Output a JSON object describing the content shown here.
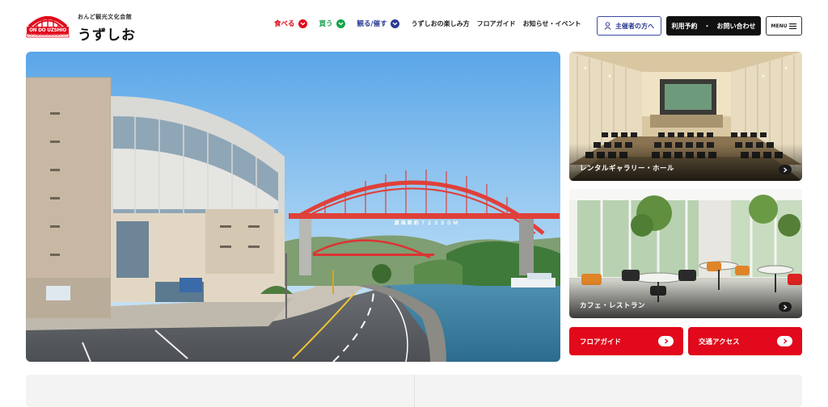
{
  "logo": {
    "badge_text": "ON DO UZSHIO",
    "badge_subtext": "ONDO KANKO BUNKA KAIKAN",
    "subtitle": "おんど観光文化会館",
    "title": "うずしお"
  },
  "nav": {
    "items": [
      {
        "label": "食べる",
        "color": "#e1091b"
      },
      {
        "label": "買う",
        "color": "#16a34a"
      },
      {
        "label": "観る/催す",
        "color": "#2b3a93"
      }
    ],
    "links": [
      "うずしおの楽しみ方",
      "フロアガイド",
      "お知らせ・イベント"
    ]
  },
  "header_buttons": {
    "organizer": "主催者の方へ",
    "reserve": "利用予約　・　お問い合わせ",
    "menu": "MENU"
  },
  "hero": {
    "bridge_sign": "渡 海 距 約 ７ ２ ３ ５ ０ Ｍ"
  },
  "cards": {
    "hall": "レンタルギャラリー・ホール",
    "cafe": "カフェ・レストラン"
  },
  "quick_links": {
    "floor_guide": "フロアガイド",
    "access": "交通アクセス"
  },
  "colors": {
    "brand_red": "#e1091b",
    "brand_green": "#16a34a",
    "brand_blue": "#2b3a93",
    "dark": "#111111"
  },
  "icons": {
    "chevron": "chevron-down-icon",
    "arrow": "arrow-right-icon",
    "person": "person-icon",
    "menu": "hamburger-icon"
  }
}
